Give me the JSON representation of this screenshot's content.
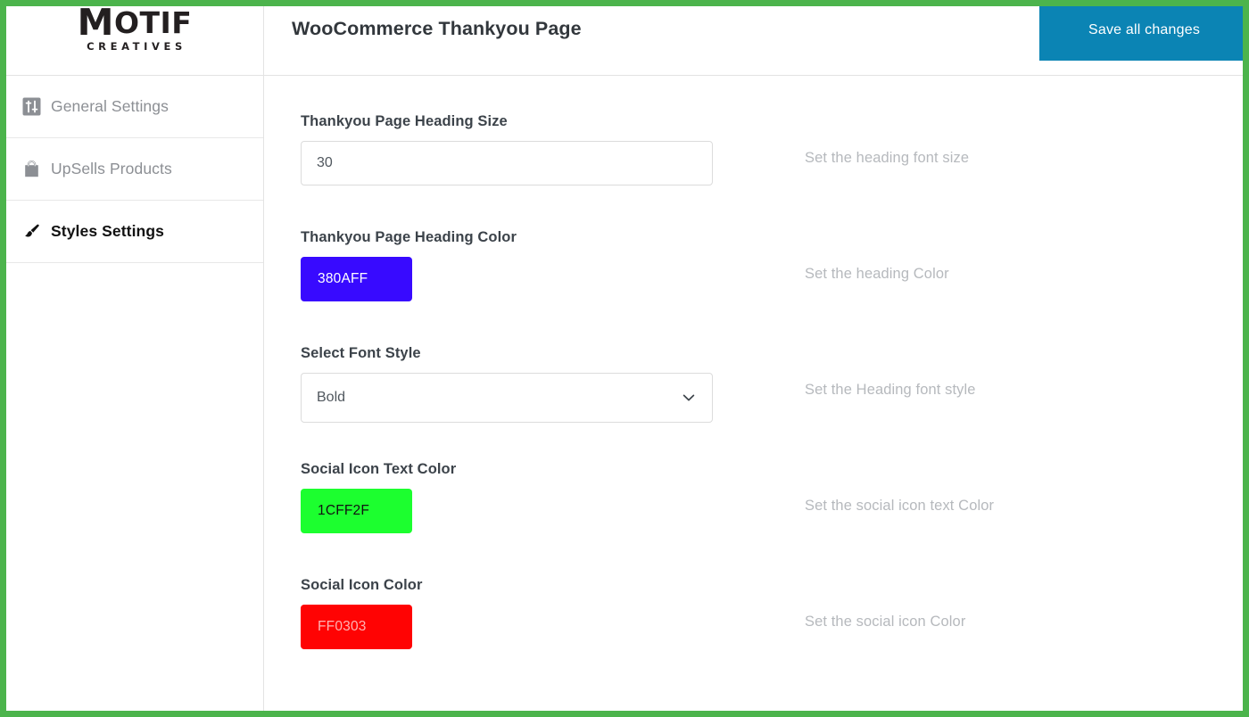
{
  "frame": {
    "border_color": "#4cb44c"
  },
  "brand": {
    "logo_main": "MOTIF",
    "logo_main_initial": "M",
    "logo_main_rest": "OTIF",
    "logo_sub": "CREATIVES"
  },
  "header": {
    "title": "WooCommerce Thankyou Page",
    "save_label": "Save all changes",
    "save_bg": "#0b84b4"
  },
  "sidebar": {
    "items": [
      {
        "label": "General Settings",
        "icon": "sliders-icon",
        "active": false
      },
      {
        "label": "UpSells Products",
        "icon": "shopping-bag-icon",
        "active": false
      },
      {
        "label": "Styles Settings",
        "icon": "paintbrush-icon",
        "active": true
      }
    ]
  },
  "main": {
    "fields": [
      {
        "label": "Thankyou Page Heading Size",
        "type": "text",
        "value": "30",
        "description": "Set the heading font size"
      },
      {
        "label": "Thankyou Page Heading Color",
        "type": "color",
        "value": "380AFF",
        "swatch_bg": "#380AFF",
        "swatch_text_color": "#ffffff",
        "description": "Set the heading Color"
      },
      {
        "label": "Select Font Style",
        "type": "select",
        "value": "Bold",
        "options": [
          "Bold"
        ],
        "description": "Set the Heading font style"
      },
      {
        "label": "Social Icon Text Color",
        "type": "color",
        "value": "1CFF2F",
        "swatch_bg": "#1CFF2F",
        "swatch_text_color": "#111111",
        "description": "Set the social icon text Color"
      },
      {
        "label": "Social Icon Color",
        "type": "color",
        "value": "FF0303",
        "swatch_bg": "#FF0303",
        "swatch_text_color": "#ffb3b3",
        "description": "Set the social icon Color"
      }
    ]
  }
}
